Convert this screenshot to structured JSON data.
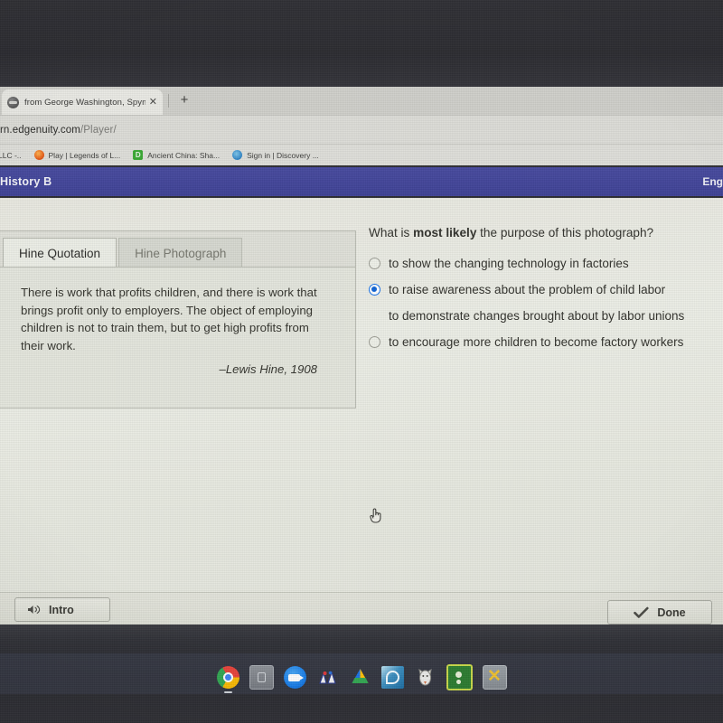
{
  "browser": {
    "tab": {
      "title": "from George Washington, Spym",
      "close_label": "✕"
    },
    "new_tab_label": "+",
    "url_main": "rn.edgenuity.com",
    "url_path": "/Player/",
    "bookmarks": [
      {
        "label": "LLC -..",
        "icon": "generic-bookmark-icon"
      },
      {
        "label": "Play | Legends of L...",
        "icon": "firefox-icon"
      },
      {
        "label": "Ancient China: Sha...",
        "icon": "duolingo-icon"
      },
      {
        "label": "Sign in | Discovery ...",
        "icon": "discovery-icon"
      }
    ]
  },
  "app_header": {
    "course_title": "History B",
    "right_label": "Eng"
  },
  "quote_panel": {
    "tabs": [
      {
        "label": "Hine Quotation",
        "active": true
      },
      {
        "label": "Hine Photograph",
        "active": false
      }
    ],
    "quote": "There is work that profits children, and there is work that brings profit only to employers. The object of employing children is not to train them, but to get high profits from their work.",
    "attribution": "–Lewis Hine, 1908"
  },
  "question": {
    "prompt_before": "What is ",
    "prompt_bold": "most likely",
    "prompt_after": " the purpose of this photograph?",
    "options": [
      {
        "label": "to show the changing technology in factories",
        "selected": false,
        "cursor": false
      },
      {
        "label": "to raise awareness about the problem of child labor",
        "selected": true,
        "cursor": false
      },
      {
        "label": "to demonstrate changes brought about by labor unions",
        "selected": false,
        "cursor": true
      },
      {
        "label": "to encourage more children to become factory workers",
        "selected": false,
        "cursor": false
      }
    ],
    "selected_color": "#1266d6"
  },
  "player_bar": {
    "intro_label": "Intro",
    "intro_icon": "speaker-icon",
    "done_label": "Done",
    "done_icon": "check-icon"
  },
  "shelf": {
    "icons": [
      {
        "name": "chrome-icon"
      },
      {
        "name": "files-icon"
      },
      {
        "name": "zoom-icon"
      },
      {
        "name": "kami-icon"
      },
      {
        "name": "google-drive-icon"
      },
      {
        "name": "pear-deck-icon"
      },
      {
        "name": "cat-app-icon"
      },
      {
        "name": "google-classroom-icon"
      },
      {
        "name": "x-app-icon"
      }
    ]
  }
}
